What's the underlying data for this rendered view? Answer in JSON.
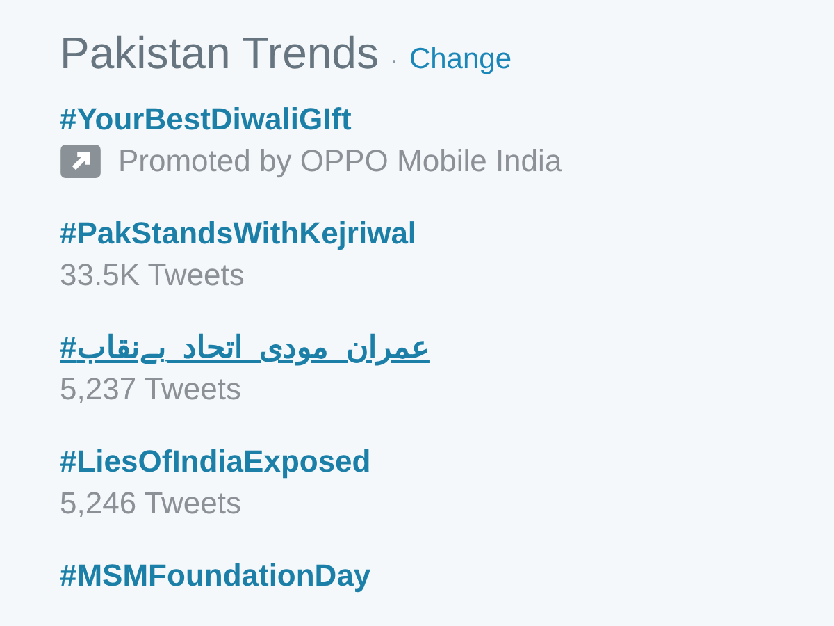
{
  "header": {
    "title": "Pakistan Trends",
    "separator": "·",
    "link": "Change"
  },
  "trends": [
    {
      "hashtag": "#YourBestDiwaliGIft",
      "hovered": false,
      "kind": "promoted",
      "meta": "Promoted by OPPO Mobile India"
    },
    {
      "hashtag": "#PakStandsWithKejriwal",
      "hovered": false,
      "kind": "count",
      "meta": "33.5K Tweets"
    },
    {
      "hashtag": "#عمران_مودی_اتحاد_بےنقاب",
      "hovered": true,
      "kind": "count",
      "meta": "5,237 Tweets"
    },
    {
      "hashtag": "#LiesOfIndiaExposed",
      "hovered": false,
      "kind": "count",
      "meta": "5,246 Tweets"
    },
    {
      "hashtag": "#MSMFoundationDay",
      "hovered": false,
      "kind": "none"
    }
  ]
}
